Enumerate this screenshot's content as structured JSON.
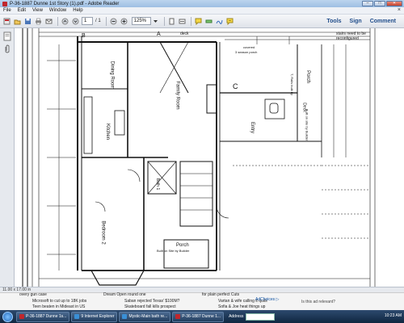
{
  "window": {
    "title": "P-36-1887 Dunne 1st Story (1).pdf - Adobe Reader",
    "controls": {
      "minimize": "–",
      "maximize": "□",
      "close": "✕"
    }
  },
  "menu": {
    "items": [
      "File",
      "Edit",
      "View",
      "Window",
      "Help"
    ],
    "close_glyph": "×"
  },
  "toolbar": {
    "page_current": "1",
    "page_total": "/ 1",
    "zoom": "125%",
    "right_links": [
      "Tools",
      "Sign",
      "Comment"
    ]
  },
  "plan": {
    "labels": {
      "marker_b": "B",
      "marker_a": "A",
      "marker_c": "C",
      "deck_top": "deck",
      "stairs_note_1": "stairs need to be",
      "stairs_note_2": "reconfigured",
      "covered_1": "covered",
      "covered_2": "3 season porch",
      "dining": "Dining Room",
      "family": "Family Room",
      "kitchen": "Kitchen",
      "entry": "Entry",
      "porch_right": "Porch",
      "porch_built": "T, Rails built by",
      "deck_right": "Deck",
      "built_on_site": "Built on site by Builder",
      "bath": "Bath 1",
      "bedroom": "Bedroom 2",
      "porch_bottom": "Porch",
      "porch_bottom_note": "Built on Site by Builder"
    }
  },
  "status": {
    "page_size": "11.00 x 17.00 in"
  },
  "background_page": {
    "headlines": [
      "Microsoft to cut up to 18K jobs",
      "Teen beaten in Mideast in US",
      "Saban rejected Texas' $100M?",
      "Skateboard fall kills prospect",
      "Vartan & wife calling it quits",
      "Sofia & Joe heat things up"
    ],
    "top_clips": [
      "overy gun case",
      "Dream Open round one",
      "for plain perfect Cuts"
    ],
    "ad_choices": "AdChoices ▷",
    "ad_relevant": "Is this ad relevant?"
  },
  "taskbar": {
    "tasks": [
      {
        "label": "P-36-1887 Dunne 1s...",
        "color": "#c0272d"
      },
      {
        "label": "9 Internet Explorer",
        "color": "#3a8fd6"
      },
      {
        "label": "Mystic-Main bath re...",
        "color": "#3a8fd6"
      },
      {
        "label": "P-36-1887 Dunne 1...",
        "color": "#c0272d"
      }
    ],
    "address_label": "Address",
    "clock": "10:23 AM"
  }
}
